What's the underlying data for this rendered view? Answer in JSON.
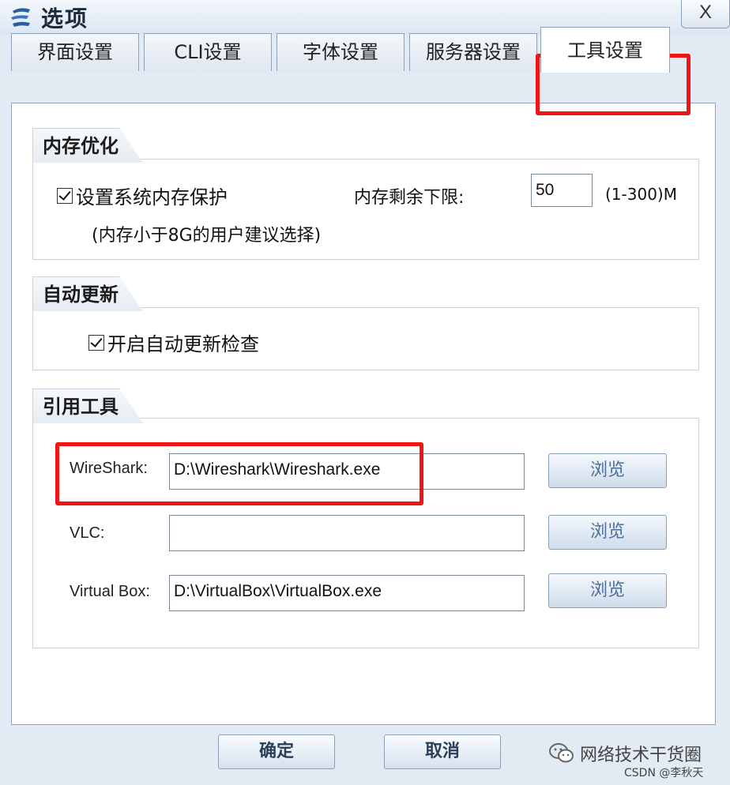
{
  "window": {
    "title": "选项",
    "close_label": "X"
  },
  "tabs": [
    {
      "label": "界面设置"
    },
    {
      "label": "CLI设置"
    },
    {
      "label": "字体设置"
    },
    {
      "label": "服务器设置"
    },
    {
      "label": "工具设置"
    }
  ],
  "memory": {
    "legend": "内存优化",
    "checkbox_label": "设置系统内存保护",
    "hint": "(内存小于8G的用户建议选择)",
    "limit_label": "内存剩余下限:",
    "limit_value": "50",
    "limit_range": "(1-300)M"
  },
  "update": {
    "legend": "自动更新",
    "checkbox_label": "开启自动更新检查"
  },
  "tools": {
    "legend": "引用工具",
    "rows": [
      {
        "label": "WireShark:",
        "value": "D:\\Wireshark\\Wireshark.exe",
        "button": "浏览"
      },
      {
        "label": "VLC:",
        "value": "",
        "button": "浏览"
      },
      {
        "label": "Virtual Box:",
        "value": "D:\\VirtualBox\\VirtualBox.exe",
        "button": "浏览"
      }
    ]
  },
  "footer": {
    "ok": "确定",
    "cancel": "取消"
  },
  "watermark": {
    "main": "网络技术干货圈",
    "sub": "CSDN @李秋天"
  },
  "colors": {
    "highlight": "#f01414",
    "accent": "#4c6e96"
  }
}
